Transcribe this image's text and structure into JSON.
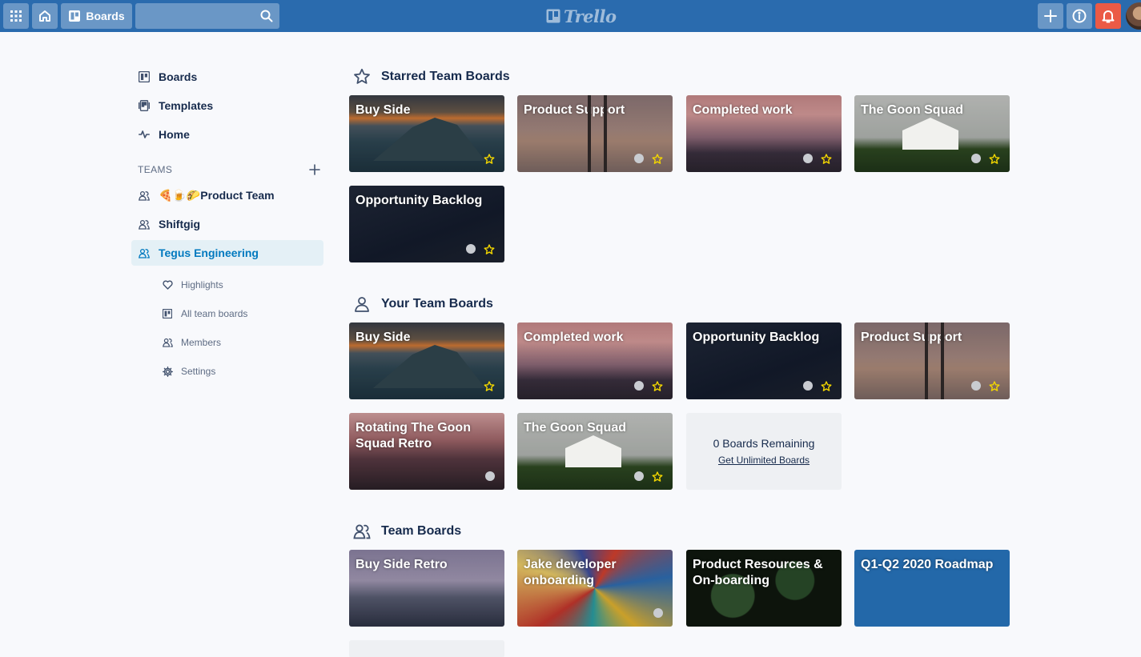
{
  "header": {
    "boards_label": "Boards",
    "search_value": "",
    "logo_text": "Trello",
    "colors": {
      "bar": "#2a6bae",
      "notification": "#eb5a46"
    },
    "icons": [
      "apps-icon",
      "home-icon",
      "boards-icon",
      "search-icon",
      "plus-icon",
      "info-icon",
      "bell-icon"
    ]
  },
  "sidebar": {
    "items": [
      {
        "label": "Boards",
        "icon": "boards-icon"
      },
      {
        "label": "Templates",
        "icon": "templates-icon"
      },
      {
        "label": "Home",
        "icon": "activity-icon"
      }
    ],
    "teams_label": "TEAMS",
    "teams": [
      {
        "label": "🍕🍺🌮Product Team",
        "icon": "team-icon"
      },
      {
        "label": "Shiftgig",
        "icon": "team-icon"
      },
      {
        "label": "Tegus Engineering",
        "icon": "team-icon",
        "active": true
      }
    ],
    "sub_items": [
      {
        "label": "Highlights",
        "icon": "heart-icon"
      },
      {
        "label": "All team boards",
        "icon": "boards-icon"
      },
      {
        "label": "Members",
        "icon": "members-icon"
      },
      {
        "label": "Settings",
        "icon": "gear-icon"
      }
    ]
  },
  "sections": {
    "starred": {
      "title": "Starred Team Boards",
      "boards": [
        "Buy Side",
        "Product Support",
        "Completed work",
        "The Goon Squad",
        "Opportunity Backlog"
      ]
    },
    "yours": {
      "title": "Your Team Boards",
      "boards": [
        "Buy Side",
        "Completed work",
        "Opportunity Backlog",
        "Product Support",
        "Rotating The Goon Squad Retro",
        "The Goon Squad"
      ],
      "remaining_text": "0 Boards Remaining",
      "remaining_link": "Get Unlimited Boards"
    },
    "team": {
      "title": "Team Boards",
      "boards": [
        "Buy Side Retro",
        "Jake developer onboarding",
        "Product Resources & On-boarding",
        "Q1-Q2 2020 Roadmap"
      ]
    }
  },
  "colors": {
    "star": "#f2d600",
    "active_team_bg": "#e4f0f6",
    "active_team_text": "#0079bf",
    "roadmap_tile": "#2368a9"
  }
}
